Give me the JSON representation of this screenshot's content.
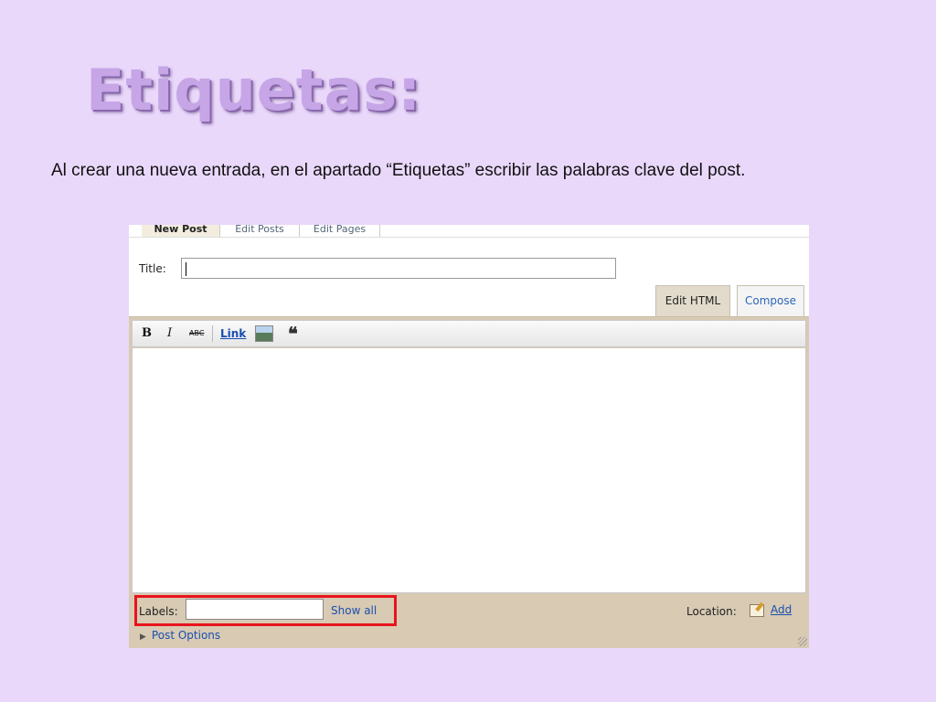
{
  "slide": {
    "title": "Etiquetas:",
    "text": "Al crear una nueva entrada, en el apartado “Etiquetas” escribir las palabras clave del post."
  },
  "editor": {
    "tabs": [
      {
        "label": "New Post",
        "active": true
      },
      {
        "label": "Edit Posts",
        "active": false
      },
      {
        "label": "Edit Pages",
        "active": false
      }
    ],
    "title_label": "Title:",
    "title_value": "",
    "mode_tabs": {
      "edit_html": "Edit HTML",
      "compose": "Compose"
    },
    "toolbar": {
      "bold": "B",
      "italic": "I",
      "strike": "ABC",
      "link": "Link",
      "image_icon": "image-icon",
      "quote": "❝"
    },
    "labels": {
      "label": "Labels:",
      "value": "",
      "show_all": "Show all"
    },
    "location": {
      "label": "Location:",
      "icon": "map-pin-icon",
      "add": "Add"
    },
    "post_options": "Post Options",
    "colors": {
      "background": "#ead8fb",
      "highlight": "#e8141c",
      "frame": "#d8cab3",
      "link": "#1a4fb0"
    }
  }
}
